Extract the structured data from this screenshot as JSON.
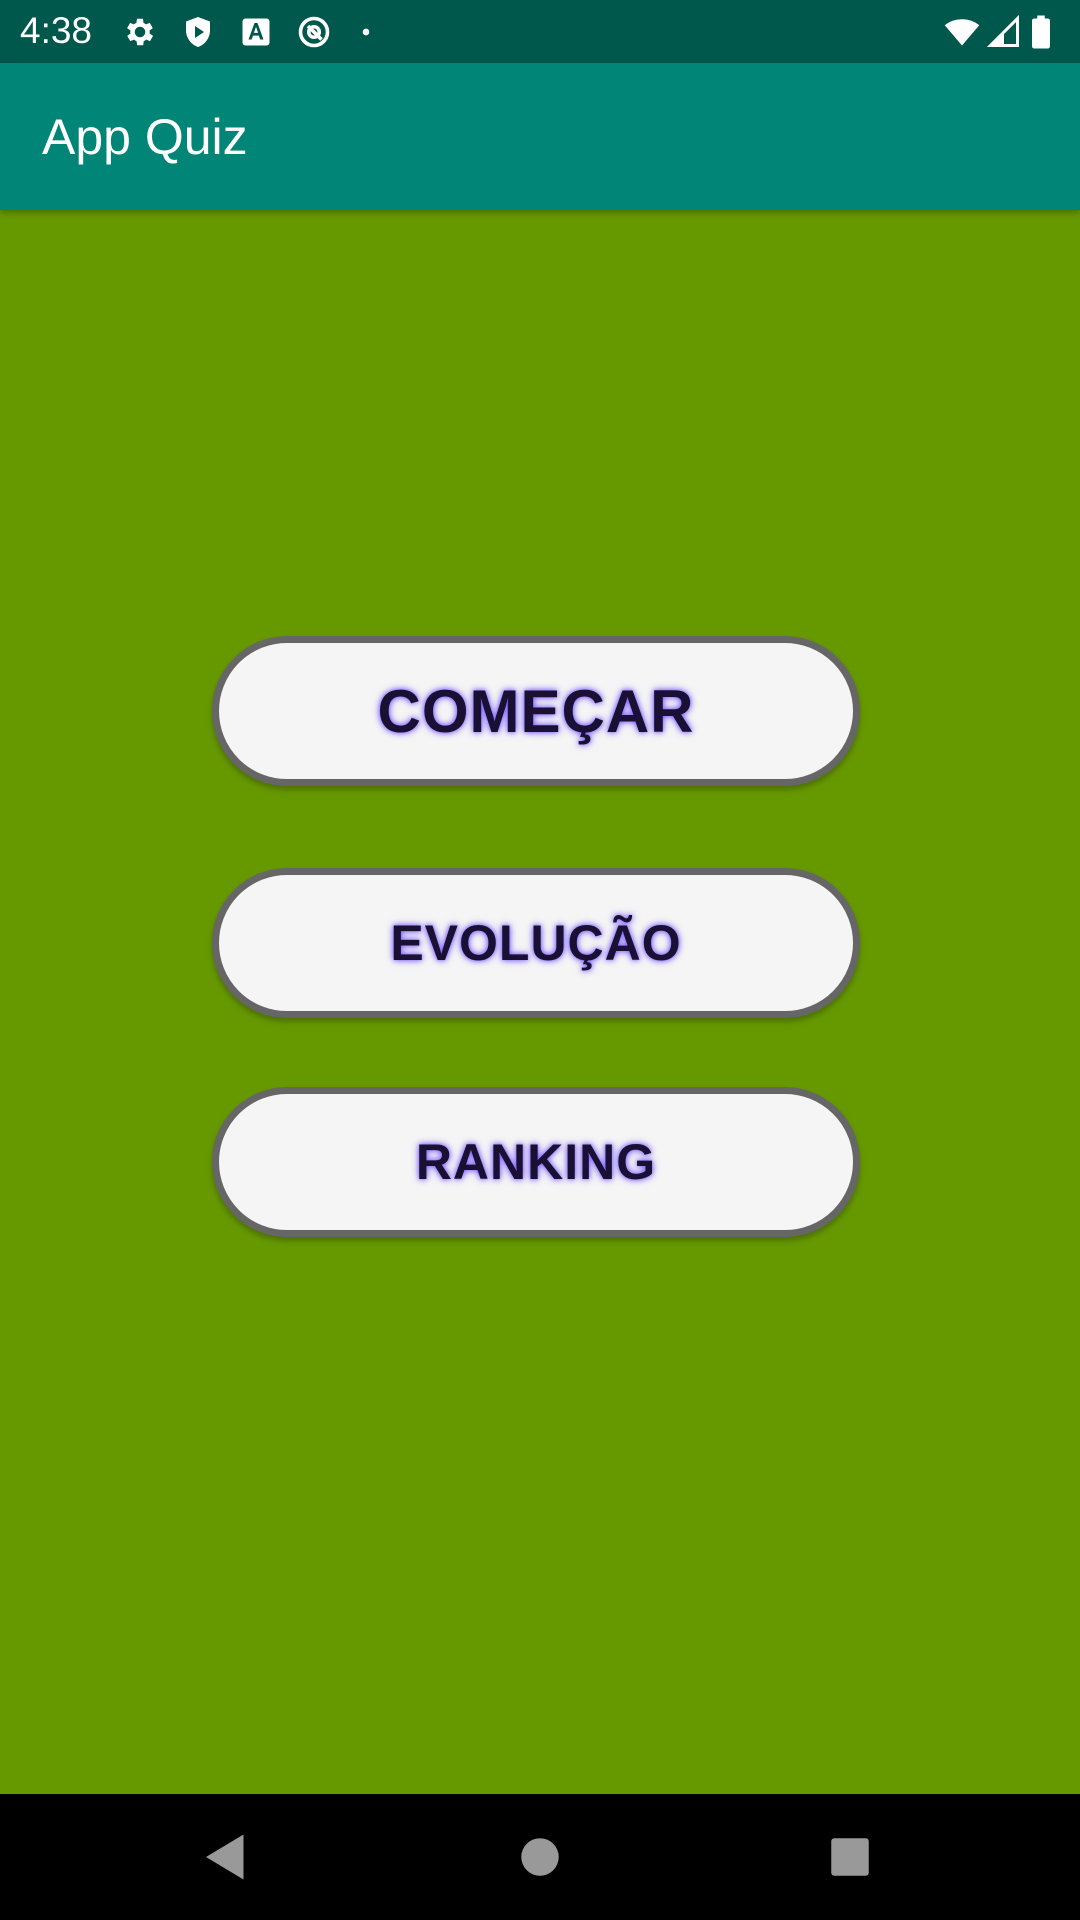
{
  "status_bar": {
    "time": "4:38",
    "left_icons": [
      "settings-icon",
      "shield-icon",
      "font-a-icon",
      "at-sign-icon",
      "dot-icon"
    ],
    "right_icons": [
      "wifi-icon",
      "signal-icon",
      "battery-icon"
    ]
  },
  "app_bar": {
    "title": "App Quiz"
  },
  "menu": {
    "start_label": "COMEÇAR",
    "evolution_label": "EVOLUÇÃO",
    "ranking_label": "RANKING"
  },
  "nav_bar": {
    "icons": [
      "back-icon",
      "home-icon",
      "recents-icon"
    ]
  },
  "colors": {
    "status_bar": "#00574B",
    "app_bar": "#008577",
    "background": "#669900",
    "button_fill": "#F5F5F5",
    "button_border": "#666666",
    "button_text": "#1a1033",
    "button_glow": "#7a5cff"
  }
}
